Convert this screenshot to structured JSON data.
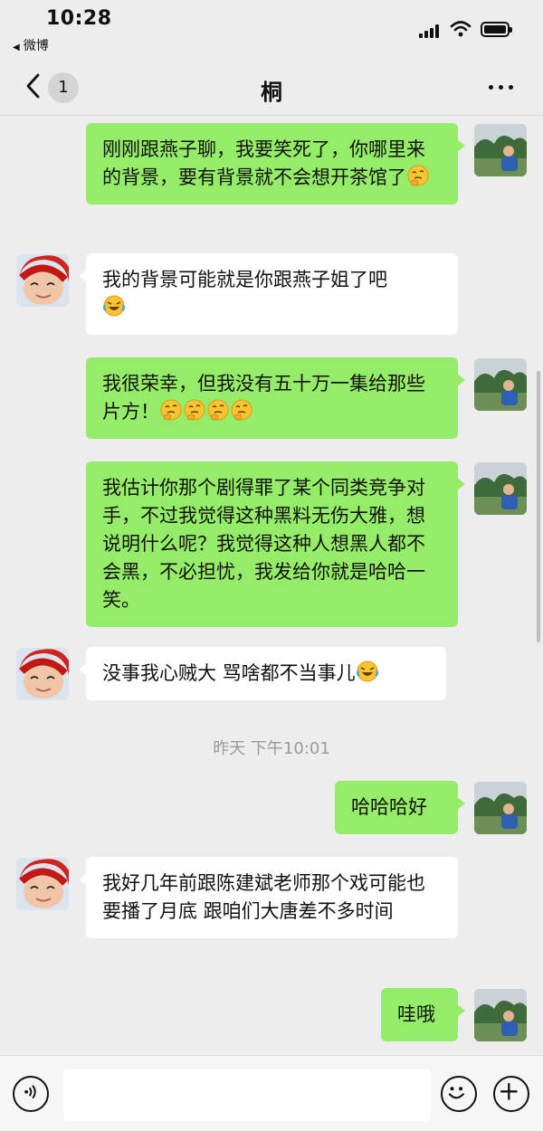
{
  "status_bar": {
    "time": "10:28",
    "back_app_label": "微博"
  },
  "nav": {
    "unread_count": "1",
    "title": "桐",
    "icons": [
      "back-chevron-icon",
      "more-icon"
    ]
  },
  "messages": [
    {
      "side": "right",
      "text": "刚刚跟燕子聊，我要笑死了，你哪里来的背景，要有背景就不会想开茶馆了",
      "emoji": [
        "thinking-emoji"
      ]
    },
    {
      "side": "left",
      "text": "我的背景可能就是你跟燕子姐了吧",
      "emoji": [
        "crying-laughing-emoji"
      ]
    },
    {
      "side": "right",
      "text": "我很荣幸，但我没有五十万一集给那些片方！",
      "emoji": [
        "thinking-emoji",
        "thinking-emoji",
        "thinking-emoji",
        "thinking-emoji"
      ]
    },
    {
      "side": "right",
      "text": "我估计你那个剧得罪了某个同类竞争对手，不过我觉得这种黑料无伤大雅，想说明什么呢？我觉得这种人想黑人都不会黑，不必担忧，我发给你就是哈哈一笑。",
      "emoji": []
    },
    {
      "side": "left",
      "text": "没事我心贼大 骂啥都不当事儿",
      "emoji": [
        "crying-laughing-emoji"
      ]
    },
    {
      "side": "right",
      "text": "哈哈哈好",
      "emoji": []
    },
    {
      "side": "left",
      "text": "我好几年前跟陈建斌老师那个戏可能也要播了月底 跟咱们大唐差不多时间",
      "emoji": []
    },
    {
      "side": "right",
      "text": "哇哦",
      "emoji": []
    }
  ],
  "timestamp": "昨天 下午10:01",
  "input_bar": {
    "placeholder": "",
    "icons": [
      "voice-icon",
      "emoji-icon",
      "plus-icon"
    ]
  },
  "colors": {
    "sent_bubble": "#95ec69",
    "received_bubble": "#ffffff",
    "background": "#ededed"
  }
}
